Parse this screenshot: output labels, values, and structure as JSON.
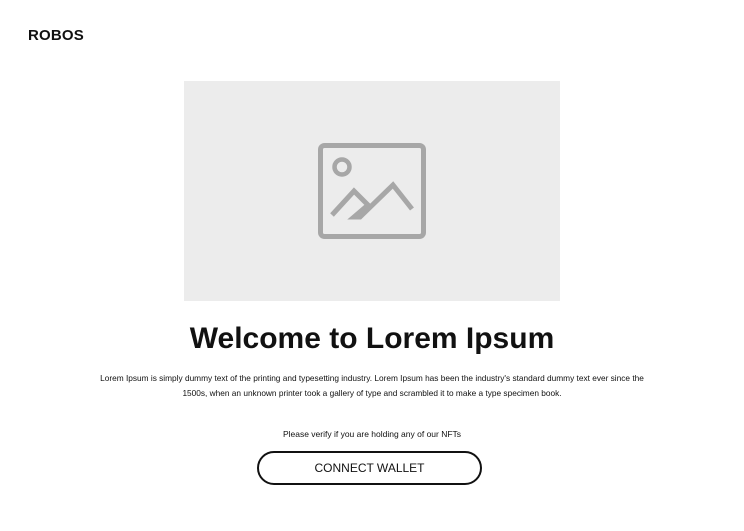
{
  "header": {
    "brand": "ROBOS"
  },
  "hero": {
    "image_icon": "image-placeholder-icon",
    "image_bg_color": "#ececec",
    "icon_color": "#a7a7a7"
  },
  "main": {
    "title": "Welcome to Lorem Ipsum",
    "description": "Lorem Ipsum is simply dummy text of the printing and typesetting industry. Lorem Ipsum has been the industry's standard dummy text ever since the 1500s, when an unknown printer took a gallery of type and scrambled it to make a type specimen book.",
    "verify_prompt": "Please verify if you are holding any of our NFTs",
    "connect_button_label": "CONNECT WALLET"
  }
}
